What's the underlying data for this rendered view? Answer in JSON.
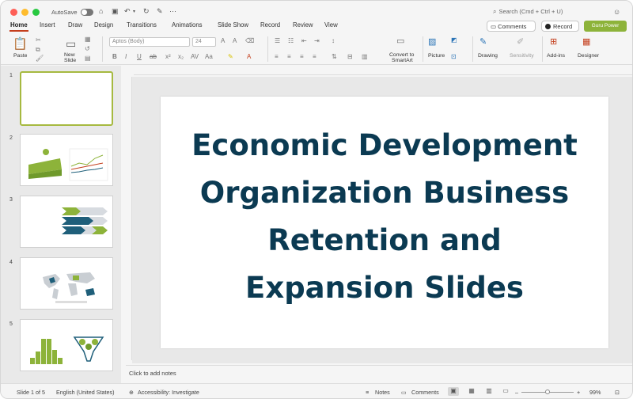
{
  "titlebar": {
    "autosave_label": "AutoSave",
    "search_placeholder": "Search (Cmd + Ctrl + U)"
  },
  "tabs": [
    "Home",
    "Insert",
    "Draw",
    "Design",
    "Transitions",
    "Animations",
    "Slide Show",
    "Record",
    "Review",
    "View"
  ],
  "active_tab": "Home",
  "actions": {
    "comments": "Comments",
    "record": "Record",
    "guru": "Guru Power"
  },
  "ribbon": {
    "paste": "Paste",
    "new_slide_1": "New",
    "new_slide_2": "Slide",
    "font_name": "Aptos (Body)",
    "font_size": "24",
    "convert_smartart_1": "Convert to",
    "convert_smartart_2": "SmartArt",
    "picture": "Picture",
    "drawing": "Drawing",
    "sensitivity": "Sensitivity",
    "addins": "Add-ins",
    "designer": "Designer"
  },
  "thumbnails": [
    {
      "num": "1",
      "kind": "blank"
    },
    {
      "num": "2",
      "kind": "farm-chart"
    },
    {
      "num": "3",
      "kind": "arrows"
    },
    {
      "num": "4",
      "kind": "map"
    },
    {
      "num": "5",
      "kind": "histogram-funnel"
    }
  ],
  "slide": {
    "title_lines": [
      "Economic Development",
      "Organization Business",
      "Retention and",
      "Expansion Slides"
    ]
  },
  "notes_placeholder": "Click to add notes",
  "status": {
    "slide_info": "Slide 1 of 5",
    "language": "English (United States)",
    "accessibility": "Accessibility: Investigate",
    "notes": "Notes",
    "comments": "Comments",
    "zoom_percent": "99%"
  },
  "colors": {
    "accent_red": "#c43e1c",
    "guru_green": "#8db33a",
    "title_navy": "#0b3a52",
    "thumb_green": "#8db33a",
    "thumb_blue": "#1f5f7a"
  }
}
